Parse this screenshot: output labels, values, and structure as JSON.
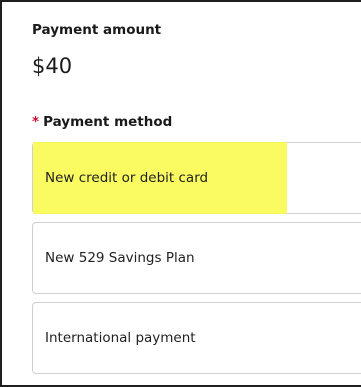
{
  "payment": {
    "amount_label": "Payment amount",
    "amount_value": "$40",
    "method_required_marker": "*",
    "method_label": "Payment method",
    "methods": [
      {
        "label": "New credit or debit card",
        "highlighted": true
      },
      {
        "label": "New 529 Savings Plan",
        "highlighted": false
      },
      {
        "label": "International payment",
        "highlighted": false
      }
    ]
  },
  "colors": {
    "highlight": "#f8fb4a",
    "required_star": "#c8102e",
    "option_border": "#cfcfcf",
    "text": "#1a1a1a"
  }
}
